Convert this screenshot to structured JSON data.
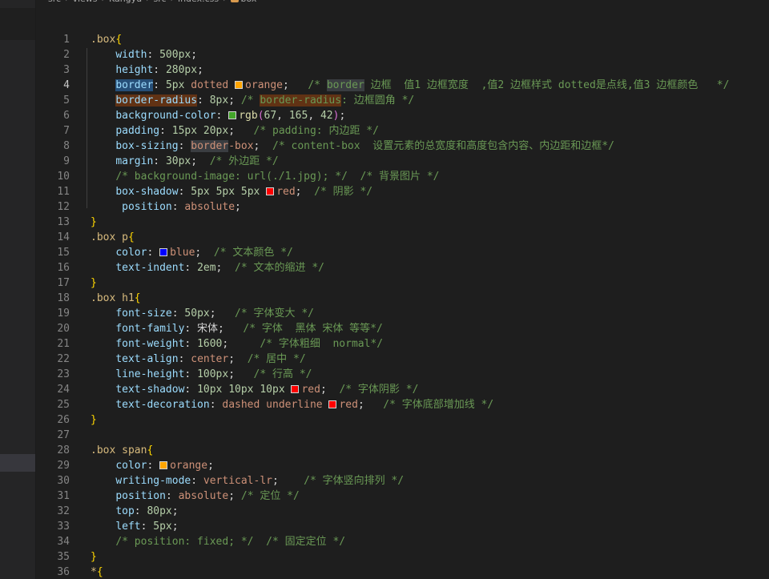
{
  "breadcrumb": [
    "src",
    "views",
    "Kangyu",
    "src",
    "index.css",
    "box"
  ],
  "colors": {
    "orange": "#ffa500",
    "green": "#43a52a",
    "red": "#ff0000",
    "blue": "#0000ff"
  },
  "lines": [
    {
      "n": "1",
      "segs": [
        {
          "c": "sel",
          "t": ".box"
        },
        {
          "c": "brace",
          "t": "{"
        }
      ]
    },
    {
      "n": "2",
      "segs": [
        {
          "c": "pun",
          "t": "    "
        },
        {
          "c": "prop",
          "t": "width"
        },
        {
          "c": "pun",
          "t": ": "
        },
        {
          "c": "num",
          "t": "500px"
        },
        {
          "c": "pun",
          "t": ";"
        }
      ]
    },
    {
      "n": "3",
      "segs": [
        {
          "c": "pun",
          "t": "    "
        },
        {
          "c": "prop",
          "t": "height"
        },
        {
          "c": "pun",
          "t": ": "
        },
        {
          "c": "num",
          "t": "280px"
        },
        {
          "c": "pun",
          "t": ";"
        }
      ]
    },
    {
      "n": "4",
      "active": true,
      "segs": [
        {
          "c": "pun",
          "t": "    "
        },
        {
          "c": "prop hl",
          "t": "border"
        },
        {
          "c": "pun",
          "t": ": "
        },
        {
          "c": "num",
          "t": "5px"
        },
        {
          "c": "pun",
          "t": " "
        },
        {
          "c": "val",
          "t": "dotted"
        },
        {
          "c": "pun",
          "t": " "
        },
        {
          "sw": "orange"
        },
        {
          "c": "val",
          "t": "orange"
        },
        {
          "c": "pun",
          "t": ";   "
        },
        {
          "c": "cmt",
          "t": "/* "
        },
        {
          "c": "cmt hl2",
          "t": "border"
        },
        {
          "c": "cmt",
          "t": " 边框  值1 边框宽度  ,值2 边框样式 dotted是点线,值3 边框颜色   */"
        }
      ]
    },
    {
      "n": "5",
      "segs": [
        {
          "c": "pun",
          "t": "    "
        },
        {
          "c": "prop hl3",
          "t": "border-radius"
        },
        {
          "c": "pun",
          "t": ": "
        },
        {
          "c": "num",
          "t": "8px"
        },
        {
          "c": "pun",
          "t": "; "
        },
        {
          "c": "cmt",
          "t": "/* "
        },
        {
          "c": "cmt hl3",
          "t": "border-radius"
        },
        {
          "c": "cmt",
          "t": ": 边框圆角 */"
        }
      ]
    },
    {
      "n": "6",
      "segs": [
        {
          "c": "pun",
          "t": "    "
        },
        {
          "c": "prop",
          "t": "background-color"
        },
        {
          "c": "pun",
          "t": ": "
        },
        {
          "sw": "green"
        },
        {
          "c": "fn",
          "t": "rgb"
        },
        {
          "c": "brace2",
          "t": "("
        },
        {
          "c": "num",
          "t": "67"
        },
        {
          "c": "pun",
          "t": ", "
        },
        {
          "c": "num",
          "t": "165"
        },
        {
          "c": "pun",
          "t": ", "
        },
        {
          "c": "num",
          "t": "42"
        },
        {
          "c": "brace2",
          "t": ")"
        },
        {
          "c": "pun",
          "t": ";"
        }
      ]
    },
    {
      "n": "7",
      "segs": [
        {
          "c": "pun",
          "t": "    "
        },
        {
          "c": "prop",
          "t": "padding"
        },
        {
          "c": "pun",
          "t": ": "
        },
        {
          "c": "num",
          "t": "15px"
        },
        {
          "c": "pun",
          "t": " "
        },
        {
          "c": "num",
          "t": "20px"
        },
        {
          "c": "pun",
          "t": ";   "
        },
        {
          "c": "cmt",
          "t": "/* padding: 内边距 */"
        }
      ]
    },
    {
      "n": "8",
      "segs": [
        {
          "c": "pun",
          "t": "    "
        },
        {
          "c": "prop",
          "t": "box-sizing"
        },
        {
          "c": "pun",
          "t": ": "
        },
        {
          "c": "val hl2",
          "t": "border"
        },
        {
          "c": "val",
          "t": "-box"
        },
        {
          "c": "pun",
          "t": ";  "
        },
        {
          "c": "cmt",
          "t": "/* content-box  设置元素的总宽度和高度包含内容、内边距和边框*/"
        }
      ]
    },
    {
      "n": "9",
      "segs": [
        {
          "c": "pun",
          "t": "    "
        },
        {
          "c": "prop",
          "t": "margin"
        },
        {
          "c": "pun",
          "t": ": "
        },
        {
          "c": "num",
          "t": "30px"
        },
        {
          "c": "pun",
          "t": ";  "
        },
        {
          "c": "cmt",
          "t": "/* 外边距 */"
        }
      ]
    },
    {
      "n": "10",
      "segs": [
        {
          "c": "pun",
          "t": "    "
        },
        {
          "c": "cmt",
          "t": "/* background-image: url(./1.jpg); */  /* 背景图片 */"
        }
      ]
    },
    {
      "n": "11",
      "segs": [
        {
          "c": "pun",
          "t": "    "
        },
        {
          "c": "prop",
          "t": "box-shadow"
        },
        {
          "c": "pun",
          "t": ": "
        },
        {
          "c": "num",
          "t": "5px"
        },
        {
          "c": "pun",
          "t": " "
        },
        {
          "c": "num",
          "t": "5px"
        },
        {
          "c": "pun",
          "t": " "
        },
        {
          "c": "num",
          "t": "5px"
        },
        {
          "c": "pun",
          "t": " "
        },
        {
          "sw": "red"
        },
        {
          "c": "val",
          "t": "red"
        },
        {
          "c": "pun",
          "t": ";  "
        },
        {
          "c": "cmt",
          "t": "/* 阴影 */"
        }
      ]
    },
    {
      "n": "12",
      "segs": [
        {
          "c": "pun",
          "t": "     "
        },
        {
          "c": "prop",
          "t": "position"
        },
        {
          "c": "pun",
          "t": ": "
        },
        {
          "c": "val",
          "t": "absolute"
        },
        {
          "c": "pun",
          "t": ";"
        }
      ]
    },
    {
      "n": "13",
      "segs": [
        {
          "c": "brace",
          "t": "}"
        }
      ]
    },
    {
      "n": "14",
      "segs": [
        {
          "c": "sel",
          "t": ".box p"
        },
        {
          "c": "brace",
          "t": "{"
        }
      ]
    },
    {
      "n": "15",
      "segs": [
        {
          "c": "pun",
          "t": "    "
        },
        {
          "c": "prop",
          "t": "color"
        },
        {
          "c": "pun",
          "t": ": "
        },
        {
          "sw": "blue"
        },
        {
          "c": "val",
          "t": "blue"
        },
        {
          "c": "pun",
          "t": ";  "
        },
        {
          "c": "cmt",
          "t": "/* 文本颜色 */"
        }
      ]
    },
    {
      "n": "16",
      "segs": [
        {
          "c": "pun",
          "t": "    "
        },
        {
          "c": "prop",
          "t": "text-indent"
        },
        {
          "c": "pun",
          "t": ": "
        },
        {
          "c": "num",
          "t": "2em"
        },
        {
          "c": "pun",
          "t": ";  "
        },
        {
          "c": "cmt",
          "t": "/* 文本的缩进 */"
        }
      ]
    },
    {
      "n": "17",
      "segs": [
        {
          "c": "brace",
          "t": "}"
        }
      ]
    },
    {
      "n": "18",
      "segs": [
        {
          "c": "sel",
          "t": ".box h1"
        },
        {
          "c": "brace",
          "t": "{"
        }
      ]
    },
    {
      "n": "19",
      "segs": [
        {
          "c": "pun",
          "t": "    "
        },
        {
          "c": "prop",
          "t": "font-size"
        },
        {
          "c": "pun",
          "t": ": "
        },
        {
          "c": "num",
          "t": "50px"
        },
        {
          "c": "pun",
          "t": ";   "
        },
        {
          "c": "cmt",
          "t": "/* 字体变大 */"
        }
      ]
    },
    {
      "n": "20",
      "segs": [
        {
          "c": "pun",
          "t": "    "
        },
        {
          "c": "prop",
          "t": "font-family"
        },
        {
          "c": "pun",
          "t": ": 宋体;   "
        },
        {
          "c": "cmt",
          "t": "/* 字体  黑体 宋体 等等*/"
        }
      ]
    },
    {
      "n": "21",
      "segs": [
        {
          "c": "pun",
          "t": "    "
        },
        {
          "c": "prop",
          "t": "font-weight"
        },
        {
          "c": "pun",
          "t": ": "
        },
        {
          "c": "num",
          "t": "1600"
        },
        {
          "c": "pun",
          "t": ";     "
        },
        {
          "c": "cmt",
          "t": "/* 字体粗细  normal*/"
        }
      ]
    },
    {
      "n": "22",
      "segs": [
        {
          "c": "pun",
          "t": "    "
        },
        {
          "c": "prop",
          "t": "text-align"
        },
        {
          "c": "pun",
          "t": ": "
        },
        {
          "c": "val",
          "t": "center"
        },
        {
          "c": "pun",
          "t": ";  "
        },
        {
          "c": "cmt",
          "t": "/* 居中 */"
        }
      ]
    },
    {
      "n": "23",
      "segs": [
        {
          "c": "pun",
          "t": "    "
        },
        {
          "c": "prop",
          "t": "line-height"
        },
        {
          "c": "pun",
          "t": ": "
        },
        {
          "c": "num",
          "t": "100px"
        },
        {
          "c": "pun",
          "t": ";   "
        },
        {
          "c": "cmt",
          "t": "/* 行高 */"
        }
      ]
    },
    {
      "n": "24",
      "segs": [
        {
          "c": "pun",
          "t": "    "
        },
        {
          "c": "prop",
          "t": "text-shadow"
        },
        {
          "c": "pun",
          "t": ": "
        },
        {
          "c": "num",
          "t": "10px"
        },
        {
          "c": "pun",
          "t": " "
        },
        {
          "c": "num",
          "t": "10px"
        },
        {
          "c": "pun",
          "t": " "
        },
        {
          "c": "num",
          "t": "10px"
        },
        {
          "c": "pun",
          "t": " "
        },
        {
          "sw": "red"
        },
        {
          "c": "val",
          "t": "red"
        },
        {
          "c": "pun",
          "t": ";  "
        },
        {
          "c": "cmt",
          "t": "/* 字体阴影 */"
        }
      ]
    },
    {
      "n": "25",
      "segs": [
        {
          "c": "pun",
          "t": "    "
        },
        {
          "c": "prop",
          "t": "text-decoration"
        },
        {
          "c": "pun",
          "t": ": "
        },
        {
          "c": "val",
          "t": "dashed"
        },
        {
          "c": "pun",
          "t": " "
        },
        {
          "c": "val",
          "t": "underline"
        },
        {
          "c": "pun",
          "t": " "
        },
        {
          "sw": "red"
        },
        {
          "c": "val",
          "t": "red"
        },
        {
          "c": "pun",
          "t": ";   "
        },
        {
          "c": "cmt",
          "t": "/* 字体底部增加线 */"
        }
      ]
    },
    {
      "n": "26",
      "segs": [
        {
          "c": "brace",
          "t": "}"
        }
      ]
    },
    {
      "n": "27",
      "segs": []
    },
    {
      "n": "28",
      "segs": [
        {
          "c": "sel",
          "t": ".box span"
        },
        {
          "c": "brace",
          "t": "{"
        }
      ]
    },
    {
      "n": "29",
      "segs": [
        {
          "c": "pun",
          "t": "    "
        },
        {
          "c": "prop",
          "t": "color"
        },
        {
          "c": "pun",
          "t": ": "
        },
        {
          "sw": "orange"
        },
        {
          "c": "val",
          "t": "orange"
        },
        {
          "c": "pun",
          "t": ";"
        }
      ]
    },
    {
      "n": "30",
      "segs": [
        {
          "c": "pun",
          "t": "    "
        },
        {
          "c": "prop",
          "t": "writing-mode"
        },
        {
          "c": "pun",
          "t": ": "
        },
        {
          "c": "val",
          "t": "vertical-lr"
        },
        {
          "c": "pun",
          "t": ";    "
        },
        {
          "c": "cmt",
          "t": "/* 字体竖向排列 */"
        }
      ]
    },
    {
      "n": "31",
      "segs": [
        {
          "c": "pun",
          "t": "    "
        },
        {
          "c": "prop",
          "t": "position"
        },
        {
          "c": "pun",
          "t": ": "
        },
        {
          "c": "val",
          "t": "absolute"
        },
        {
          "c": "pun",
          "t": "; "
        },
        {
          "c": "cmt",
          "t": "/* 定位 */"
        }
      ]
    },
    {
      "n": "32",
      "segs": [
        {
          "c": "pun",
          "t": "    "
        },
        {
          "c": "prop",
          "t": "top"
        },
        {
          "c": "pun",
          "t": ": "
        },
        {
          "c": "num",
          "t": "80px"
        },
        {
          "c": "pun",
          "t": ";"
        }
      ]
    },
    {
      "n": "33",
      "segs": [
        {
          "c": "pun",
          "t": "    "
        },
        {
          "c": "prop",
          "t": "left"
        },
        {
          "c": "pun",
          "t": ": "
        },
        {
          "c": "num",
          "t": "5px"
        },
        {
          "c": "pun",
          "t": ";"
        }
      ]
    },
    {
      "n": "34",
      "segs": [
        {
          "c": "pun",
          "t": "    "
        },
        {
          "c": "cmt",
          "t": "/* position: fixed; */  /* 固定定位 */"
        }
      ]
    },
    {
      "n": "35",
      "segs": [
        {
          "c": "brace",
          "t": "}"
        }
      ]
    },
    {
      "n": "36",
      "segs": [
        {
          "c": "sel",
          "t": "*"
        },
        {
          "c": "brace",
          "t": "{"
        }
      ]
    }
  ]
}
